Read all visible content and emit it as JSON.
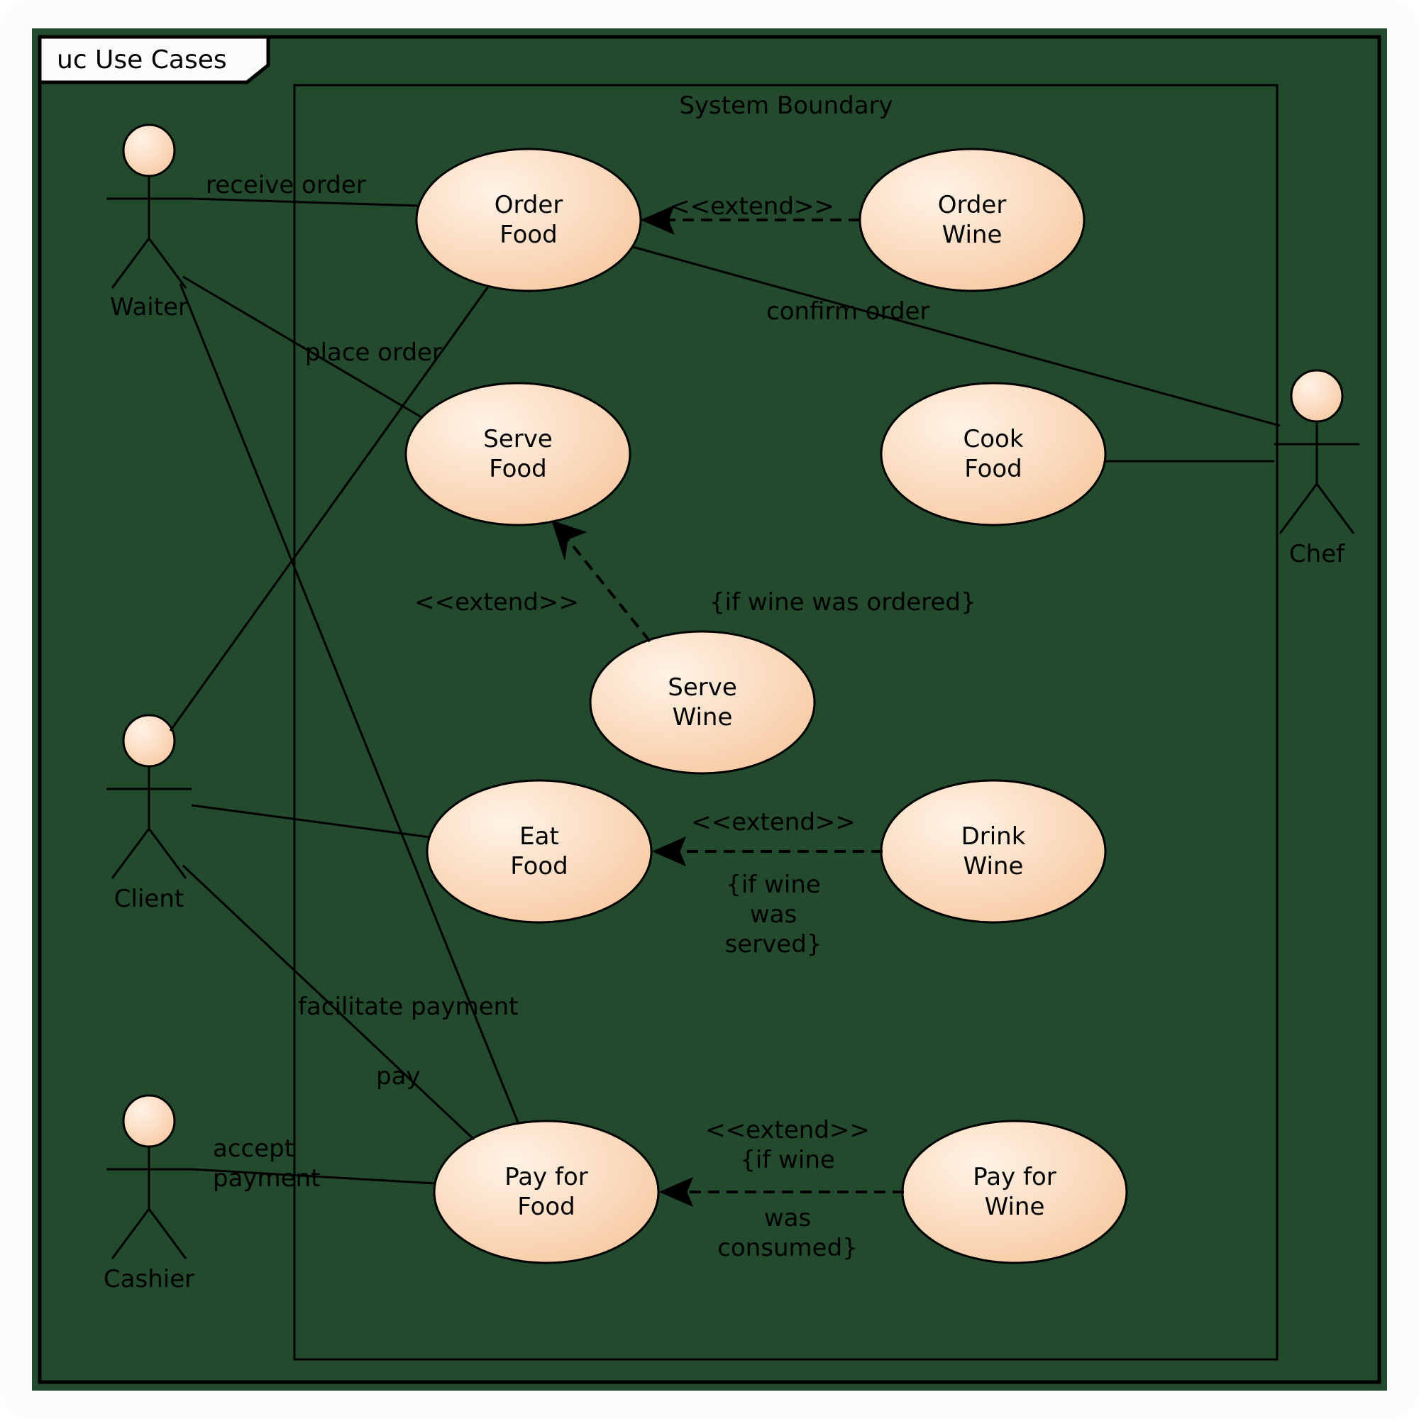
{
  "frame": {
    "title": "uc Use Cases"
  },
  "boundary": {
    "title": "System Boundary"
  },
  "actors": {
    "waiter": {
      "name": "Waiter"
    },
    "client": {
      "name": "Client"
    },
    "cashier": {
      "name": "Cashier"
    },
    "chef": {
      "name": "Chef"
    }
  },
  "usecases": {
    "order_food": {
      "l1": "Order",
      "l2": "Food"
    },
    "order_wine": {
      "l1": "Order",
      "l2": "Wine"
    },
    "serve_food": {
      "l1": "Serve",
      "l2": "Food"
    },
    "cook_food": {
      "l1": "Cook",
      "l2": "Food"
    },
    "serve_wine": {
      "l1": "Serve",
      "l2": "Wine"
    },
    "eat_food": {
      "l1": "Eat",
      "l2": "Food"
    },
    "drink_wine": {
      "l1": "Drink",
      "l2": "Wine"
    },
    "pay_food": {
      "l1": "Pay for",
      "l2": "Food"
    },
    "pay_wine": {
      "l1": "Pay for",
      "l2": "Wine"
    }
  },
  "labels": {
    "receive_order": "receive order",
    "place_order": "place order",
    "confirm_order": "confirm order",
    "facilitate_payment": "facilitate payment",
    "pay": "pay",
    "accept": "accept",
    "payment": "payment",
    "extend": "<<extend>>",
    "serve_cond": "{if wine was ordered}",
    "drink_cond1": "{if wine",
    "drink_cond2": "was",
    "drink_cond3": "served}",
    "pay_cond1": "{if wine",
    "pay_cond2": "was",
    "pay_cond3": "consumed}"
  }
}
